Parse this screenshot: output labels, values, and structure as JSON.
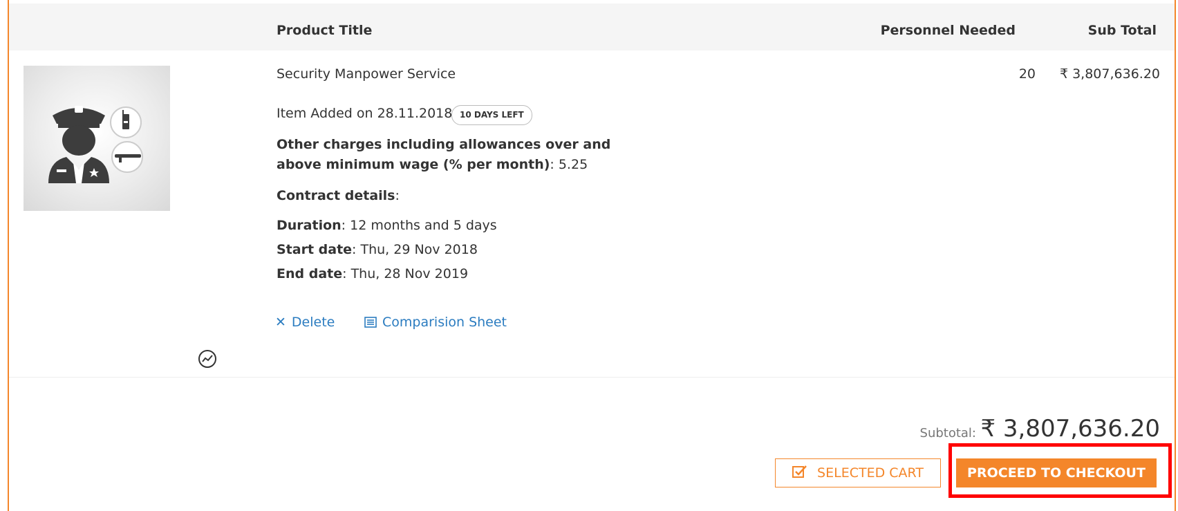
{
  "table": {
    "headers": {
      "product_title": "Product Title",
      "personnel_needed": "Personnel Needed",
      "sub_total": "Sub Total"
    }
  },
  "item": {
    "image_icon": "security-guard-icon",
    "title": "Security Manpower Service",
    "personnel": "20",
    "line_total": "₹ 3,807,636.20",
    "added_label": "Item Added on 28.11.2018",
    "days_left_badge": "10 DAYS LEFT",
    "charges_label": "Other charges including allowances over and above minimum wage (% per month)",
    "charges_value": ": 5.25",
    "contract_label": "Contract details",
    "contract_suffix": ":",
    "duration_label": "Duration",
    "duration_value": ": 12 months and 5 days",
    "start_label": "Start date",
    "start_value": ": Thu, 29 Nov 2018",
    "end_label": "End date",
    "end_value": ": Thu, 28 Nov 2019",
    "delete_label": "Delete",
    "compare_label": "Comparision Sheet"
  },
  "summary": {
    "subtotal_label": "Subtotal:",
    "subtotal_value": "₹ 3,807,636.20",
    "selected_cart_label": "SELECTED CART",
    "checkout_label": "PROCEED TO CHECKOUT"
  },
  "colors": {
    "accent": "#f4862a",
    "link": "#2b7cc0",
    "highlight": "#ff0000"
  }
}
